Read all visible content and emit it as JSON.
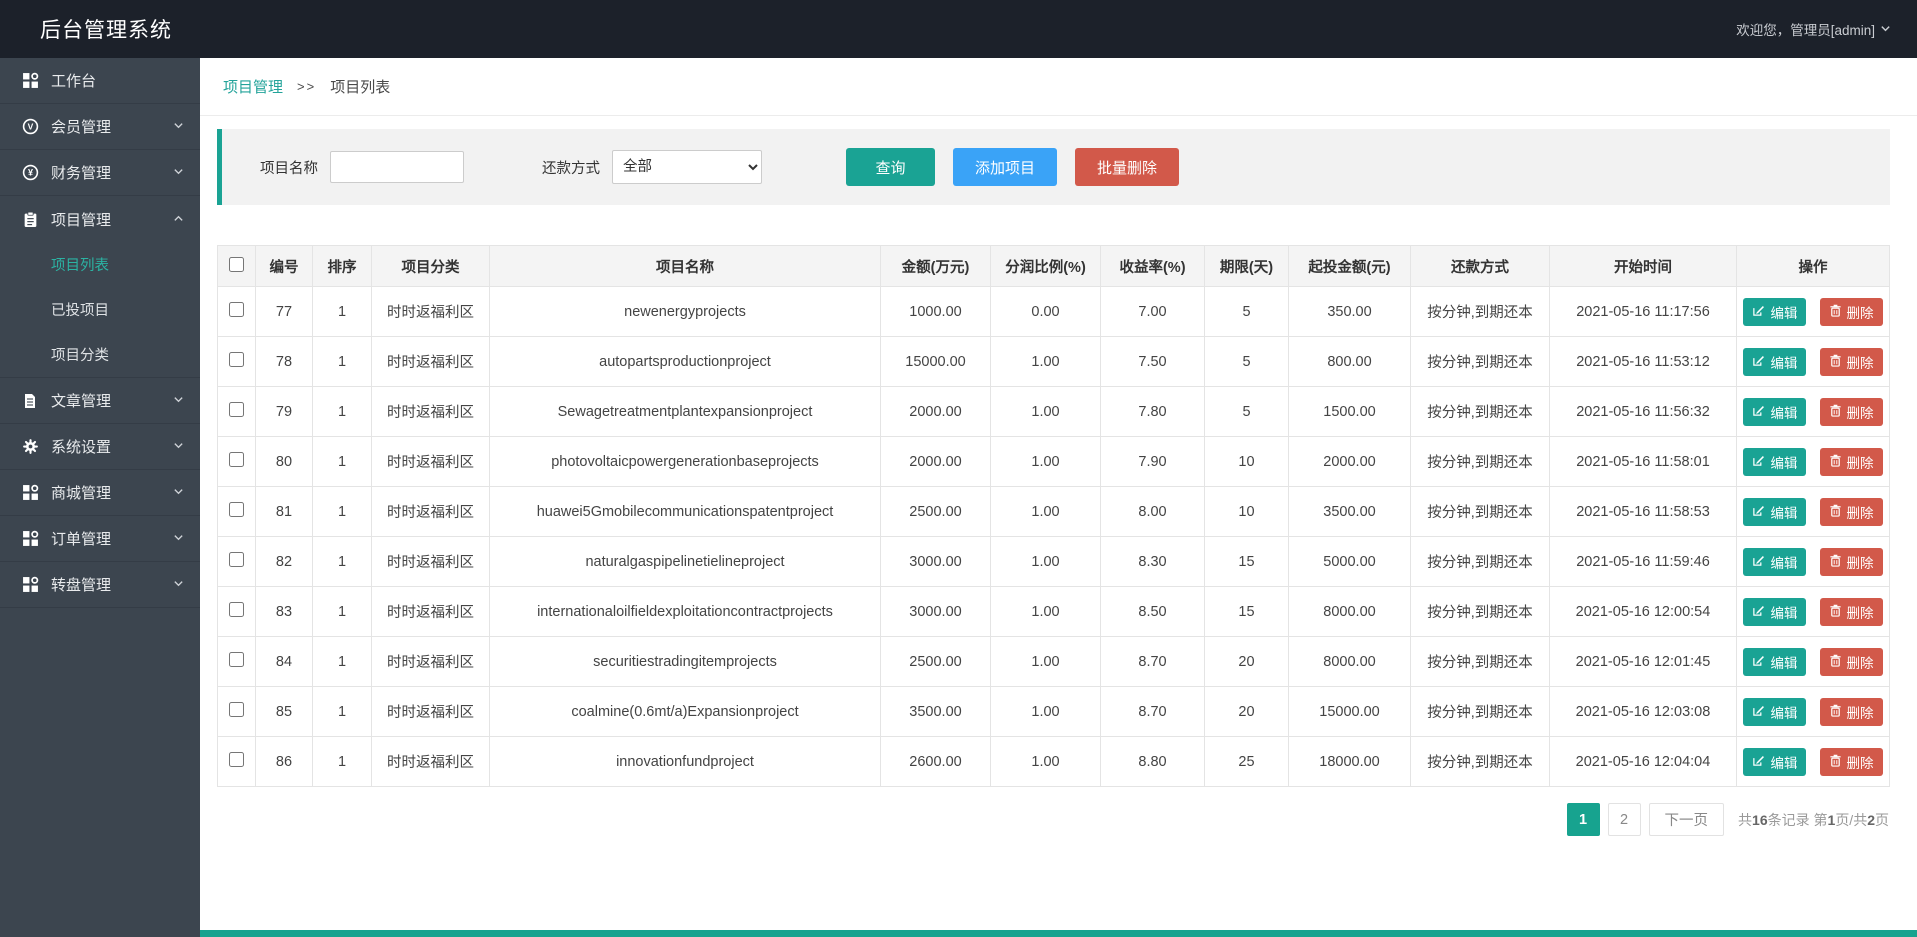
{
  "colors": {
    "accent_teal": "#1aa394",
    "primary_blue": "#3aa3f7",
    "danger_red": "#d2594a",
    "topbar_bg": "#1c212a",
    "sidebar_bg": "#3c454f"
  },
  "topbar": {
    "title": "后台管理系统",
    "welcome": "欢迎您，管理员[admin]"
  },
  "breadcrumb": {
    "section": "项目管理",
    "separator": ">>",
    "current": "项目列表"
  },
  "sidebar": {
    "items": [
      {
        "label": "工作台"
      },
      {
        "label": "会员管理"
      },
      {
        "label": "财务管理"
      },
      {
        "label": "项目管理",
        "children": [
          {
            "label": "项目列表",
            "active": true
          },
          {
            "label": "已投项目"
          },
          {
            "label": "项目分类"
          }
        ]
      },
      {
        "label": "文章管理"
      },
      {
        "label": "系统设置"
      },
      {
        "label": "商城管理"
      },
      {
        "label": "订单管理"
      },
      {
        "label": "转盘管理"
      }
    ]
  },
  "filters": {
    "name_label": "项目名称",
    "repay_label": "还款方式",
    "repay_value": "全部",
    "search_button": "查询",
    "add_button": "添加项目",
    "bulk_delete_button": "批量删除"
  },
  "table": {
    "headers": [
      "编号",
      "排序",
      "项目分类",
      "项目名称",
      "金额(万元)",
      "分润比例(%)",
      "收益率(%)",
      "期限(天)",
      "起投金额(元)",
      "还款方式",
      "开始时间",
      "操作"
    ],
    "edit_label": "编辑",
    "delete_label": "删除",
    "rows": [
      {
        "id": "77",
        "sort": "1",
        "category": "时时返福利区",
        "name": "newenergyprojects",
        "amount": "1000.00",
        "share": "0.00",
        "rate": "7.00",
        "days": "5",
        "min_invest": "350.00",
        "repay": "按分钟,到期还本",
        "start_time": "2021-05-16 11:17:56"
      },
      {
        "id": "78",
        "sort": "1",
        "category": "时时返福利区",
        "name": "autopartsproductionproject",
        "amount": "15000.00",
        "share": "1.00",
        "rate": "7.50",
        "days": "5",
        "min_invest": "800.00",
        "repay": "按分钟,到期还本",
        "start_time": "2021-05-16 11:53:12"
      },
      {
        "id": "79",
        "sort": "1",
        "category": "时时返福利区",
        "name": "Sewagetreatmentplantexpansionproject",
        "amount": "2000.00",
        "share": "1.00",
        "rate": "7.80",
        "days": "5",
        "min_invest": "1500.00",
        "repay": "按分钟,到期还本",
        "start_time": "2021-05-16 11:56:32"
      },
      {
        "id": "80",
        "sort": "1",
        "category": "时时返福利区",
        "name": "photovoltaicpowergenerationbaseprojects",
        "amount": "2000.00",
        "share": "1.00",
        "rate": "7.90",
        "days": "10",
        "min_invest": "2000.00",
        "repay": "按分钟,到期还本",
        "start_time": "2021-05-16 11:58:01"
      },
      {
        "id": "81",
        "sort": "1",
        "category": "时时返福利区",
        "name": "huawei5Gmobilecommunicationspatentproject",
        "amount": "2500.00",
        "share": "1.00",
        "rate": "8.00",
        "days": "10",
        "min_invest": "3500.00",
        "repay": "按分钟,到期还本",
        "start_time": "2021-05-16 11:58:53"
      },
      {
        "id": "82",
        "sort": "1",
        "category": "时时返福利区",
        "name": "naturalgaspipelinetielineproject",
        "amount": "3000.00",
        "share": "1.00",
        "rate": "8.30",
        "days": "15",
        "min_invest": "5000.00",
        "repay": "按分钟,到期还本",
        "start_time": "2021-05-16 11:59:46"
      },
      {
        "id": "83",
        "sort": "1",
        "category": "时时返福利区",
        "name": "internationaloilfieldexploitationcontractprojects",
        "amount": "3000.00",
        "share": "1.00",
        "rate": "8.50",
        "days": "15",
        "min_invest": "8000.00",
        "repay": "按分钟,到期还本",
        "start_time": "2021-05-16 12:00:54"
      },
      {
        "id": "84",
        "sort": "1",
        "category": "时时返福利区",
        "name": "securitiestradingitemprojects",
        "amount": "2500.00",
        "share": "1.00",
        "rate": "8.70",
        "days": "20",
        "min_invest": "8000.00",
        "repay": "按分钟,到期还本",
        "start_time": "2021-05-16 12:01:45"
      },
      {
        "id": "85",
        "sort": "1",
        "category": "时时返福利区",
        "name": "coalmine(0.6mt/a)Expansionproject",
        "amount": "3500.00",
        "share": "1.00",
        "rate": "8.70",
        "days": "20",
        "min_invest": "15000.00",
        "repay": "按分钟,到期还本",
        "start_time": "2021-05-16 12:03:08"
      },
      {
        "id": "86",
        "sort": "1",
        "category": "时时返福利区",
        "name": "innovationfundproject",
        "amount": "2600.00",
        "share": "1.00",
        "rate": "8.80",
        "days": "25",
        "min_invest": "18000.00",
        "repay": "按分钟,到期还本",
        "start_time": "2021-05-16 12:04:04"
      }
    ]
  },
  "pagination": {
    "pages": [
      "1",
      "2"
    ],
    "active_page": "1",
    "next_label": "下一页",
    "summary_parts": [
      "共",
      "16",
      "条记录 第",
      "1",
      "页/共",
      "2",
      "页"
    ]
  }
}
